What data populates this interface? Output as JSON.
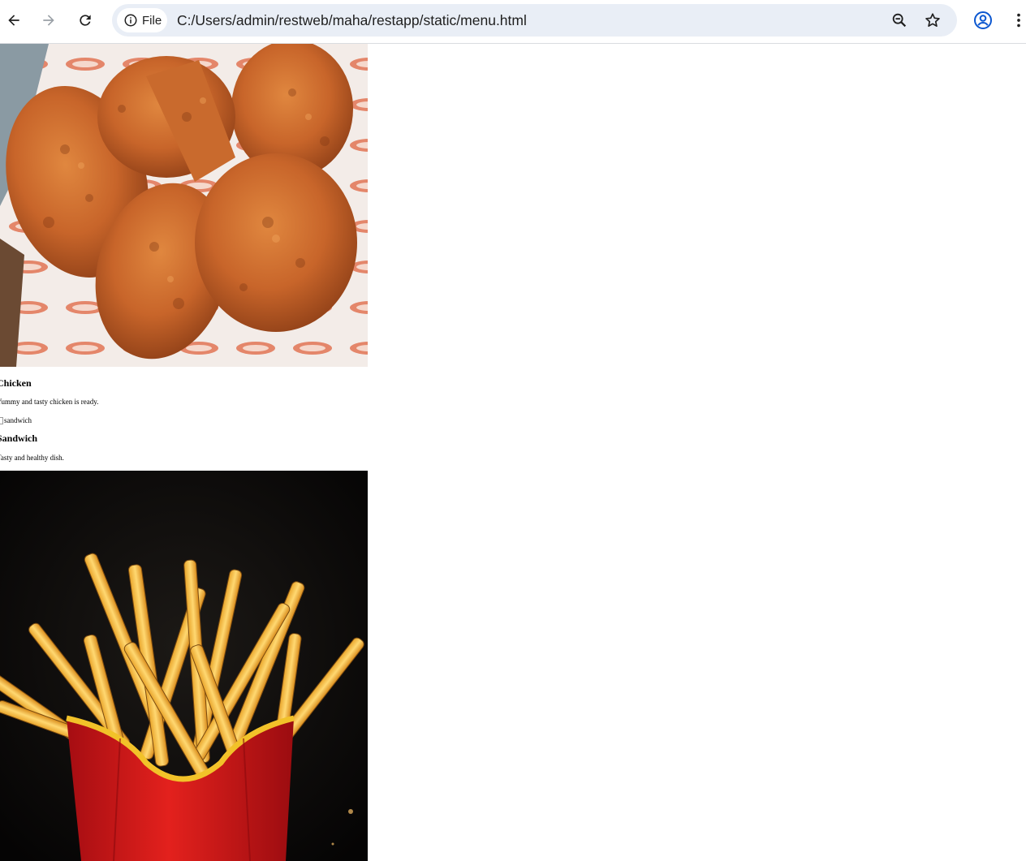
{
  "browser": {
    "site_chip_label": "File",
    "url": "C:/Users/admin/restweb/maha/restapp/static/menu.html"
  },
  "menu": {
    "items": [
      {
        "title": "Chicken",
        "description": "Yummy and tasty chicken is ready.",
        "image_icon": "fried-chicken-photo"
      },
      {
        "broken_image_alt": "sandwich",
        "title": "Sandwich",
        "description": "Tasty and healthy dish."
      },
      {
        "image_icon": "french-fries-photo"
      }
    ]
  },
  "colors": {
    "omnibox_bg": "#e9eef6",
    "profile_blue": "#0b57d0",
    "fries_box_red": "#d4161c",
    "fries_bg": "#0f0d0c"
  }
}
